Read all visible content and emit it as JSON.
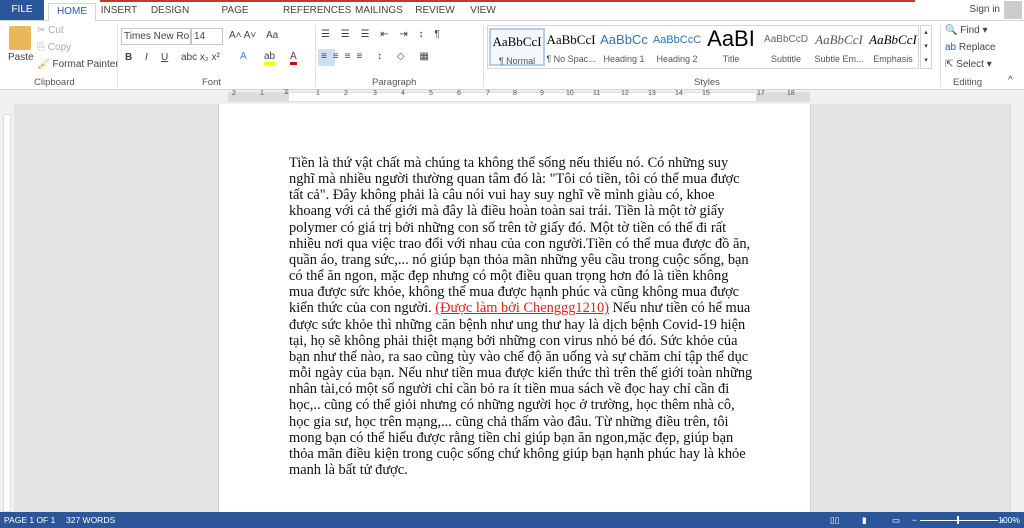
{
  "tabs": [
    "FILE",
    "HOME",
    "INSERT",
    "DESIGN",
    "PAGE LAYOUT",
    "REFERENCES",
    "MAILINGS",
    "REVIEW",
    "VIEW"
  ],
  "active_tab": "HOME",
  "account": {
    "sign_in": "Sign in"
  },
  "clipboard": {
    "paste": "Paste",
    "cut": "Cut",
    "copy": "Copy",
    "format_painter": "Format Painter",
    "label": "Clipboard"
  },
  "font": {
    "name": "Times New Ro",
    "size": "14",
    "label": "Font",
    "change_case": "Aa"
  },
  "paragraph": {
    "label": "Paragraph"
  },
  "styles": {
    "label": "Styles",
    "items": [
      {
        "preview": "AaBbCcI",
        "name": "¶ Normal"
      },
      {
        "preview": "AaBbCcI",
        "name": "¶ No Spac..."
      },
      {
        "preview": "AaBbCc",
        "name": "Heading 1"
      },
      {
        "preview": "AaBbCcC",
        "name": "Heading 2"
      },
      {
        "preview": "AaBI",
        "name": "Title"
      },
      {
        "preview": "AaBbCcD",
        "name": "Subtitle"
      },
      {
        "preview": "AaBbCcI",
        "name": "Subtle Em..."
      },
      {
        "preview": "AaBbCcI",
        "name": "Emphasis"
      }
    ]
  },
  "editing": {
    "find": "Find",
    "replace": "Replace",
    "select": "Select",
    "label": "Editing"
  },
  "ruler": {
    "numbers": [
      "2",
      "1",
      "1",
      "2",
      "3",
      "4",
      "5",
      "6",
      "7",
      "8",
      "9",
      "10",
      "11",
      "12",
      "13",
      "14",
      "15",
      "17",
      "18"
    ]
  },
  "document": {
    "lines": [
      "Tiền là thứ vật chất mà chúng ta không thể sống nếu thiếu nó. Có những suy",
      "nghĩ mà nhiều người thường quan tâm đó là: \"Tôi có tiền, tôi có thể mua được",
      "tất cả\". Đây không phải là câu nói vui hay suy nghĩ về mình giàu có, khoe",
      "khoang với cả thế giới mà đây là điều hoàn toàn sai trái. Tiền là một tờ giấy",
      "polymer có giá trị bởi những con số trên tờ giấy đó. Một tờ tiền có thể đi rất",
      "nhiều nơi qua việc trao đổi với nhau của con người.Tiền có thể mua được đồ ăn,",
      "quần áo, trang sức,... nó giúp bạn thỏa mãn những yêu cầu trong cuộc sống, bạn",
      "có thể ăn ngon, mặc đẹp nhưng có một điều quan trọng hơn đó là tiền không",
      "mua được sức khỏe, không thể mua được hạnh phúc và cũng không mua được"
    ],
    "line10_before": "kiến thức của con người. ",
    "credit": "(Được làm bởi Chenggg1210)",
    "line10_after": " Nếu như tiền có hể mua",
    "lines_after": [
      "được sức khỏe thì những căn bệnh như ung thư hay là dịch bệnh Covid-19 hiện",
      "tại, họ sẽ không phải thiệt mạng bởi những con virus nhỏ bé đó. Sức khỏe của",
      "bạn như thế nào, ra sao cũng tùy vào chế độ ăn uống và sự chăm chỉ tập thể dục",
      "mỗi ngày của bạn. Nếu như tiền mua được kiến thức thì trên thế giới toàn những",
      "nhân tài,có một số người chỉ cần bỏ ra ít tiền mua sách về đọc hay chỉ cần đi",
      "học,.. cũng có thể giỏi nhưng có những người học ở trường, học thêm nhà cô,",
      "học gia sư, học trên mạng,... cũng chả thấm vào đâu. Từ những điều trên, tôi",
      "mong bạn có thể hiểu được rằng tiền chỉ giúp bạn ăn ngon,mặc đẹp, giúp bạn",
      "thỏa mãn điều kiện trong cuộc sống chứ không giúp bạn hạnh phúc hay là khỏe",
      "manh là bất tử được."
    ]
  },
  "status": {
    "page": "PAGE 1 OF 1",
    "words": "327 WORDS",
    "zoom": "100%"
  },
  "colors": {
    "brand": "#2b579a",
    "credit": "#e0201a"
  }
}
